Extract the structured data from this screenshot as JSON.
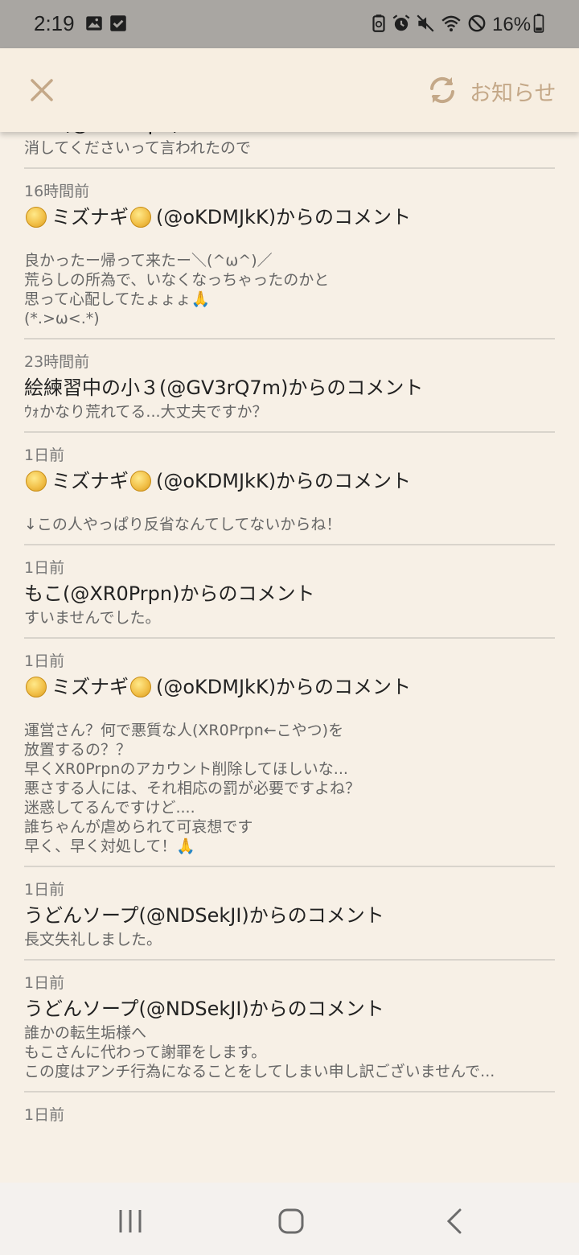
{
  "status": {
    "time": "2:19",
    "battery": "16%"
  },
  "header": {
    "title": "お知らせ"
  },
  "notifications": [
    {
      "time": "",
      "head": "",
      "body": "消してくださいって言われたので"
    },
    {
      "time": "16時間前",
      "head_prefix": "ミズナギ",
      "head": "(@oKDMJkK)からのコメント",
      "body": "良かったー帰って来たー＼(^ω^)／\n荒らしの所為で、いなくなっちゃったのかと\n思って心配してたょょょ🙏\n(*.>ω<.*)"
    },
    {
      "time": "23時間前",
      "head": "絵練習中の小３(@GV3rQ7m)からのコメント",
      "body": "ｳｫかなり荒れてる...大丈夫ですか？"
    },
    {
      "time": "1日前",
      "head_prefix": "ミズナギ",
      "head": "(@oKDMJkK)からのコメント",
      "body": "↓この人やっぱり反省なんてしてないからね！"
    },
    {
      "time": "1日前",
      "head": "もこ(@XR0Prpn)からのコメント",
      "body": "すいませんでした。"
    },
    {
      "time": "1日前",
      "head_prefix": "ミズナギ",
      "head": "(@oKDMJkK)からのコメント",
      "body": "運営さん？何で悪質な人(XR0Prpn←こやつ)を\n放置するの？？\n早くXR0Prpnのアカウント削除してほしいな...\n悪さする人には、それ相応の罰が必要ですよね？\n迷惑してるんですけど....\n誰ちゃんが虐められて可哀想です\n早く、早く対処して！🙏"
    },
    {
      "time": "1日前",
      "head": "うどんソープ(@NDSekJI)からのコメント",
      "body": "長文失礼しました。"
    },
    {
      "time": "1日前",
      "head": "うどんソープ(@NDSekJI)からのコメント",
      "body": "誰かの転生垢様へ\nもこさんに代わって謝罪をします。\nこの度はアンチ行為になることをしてしまい申し訳ございませんで..."
    },
    {
      "time": "1日前",
      "head": "",
      "body": ""
    }
  ]
}
